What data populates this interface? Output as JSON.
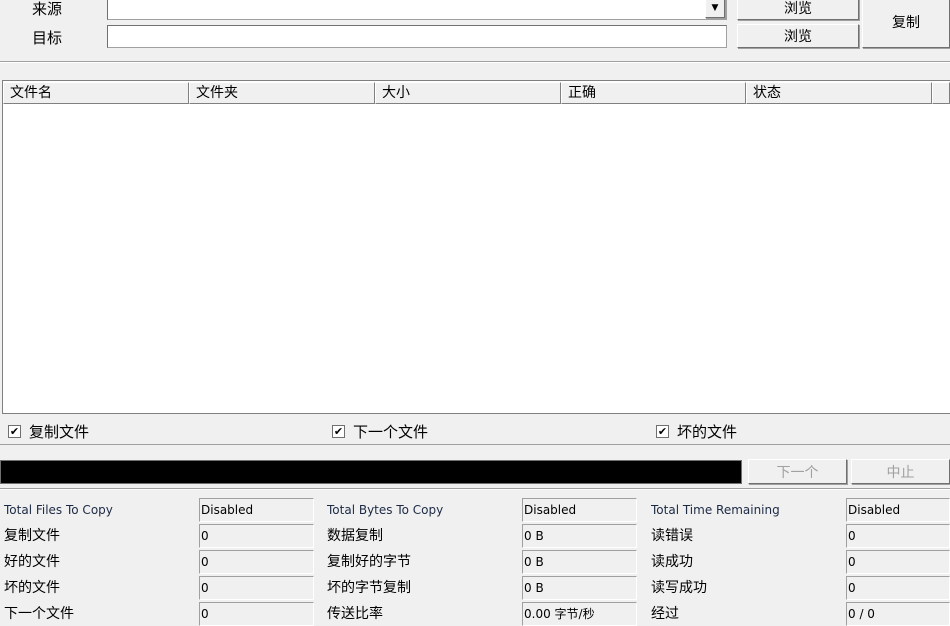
{
  "source": {
    "label": "来源",
    "value": "",
    "browse": "浏览"
  },
  "target": {
    "label": "目标",
    "value": "",
    "browse": "浏览"
  },
  "copy_button": "复制",
  "table": {
    "columns": [
      "文件名",
      "文件夹",
      "大小",
      "正确",
      "状态"
    ]
  },
  "checkboxes": [
    {
      "label": "复制文件",
      "checked": true
    },
    {
      "label": "下一个文件",
      "checked": true
    },
    {
      "label": "坏的文件",
      "checked": true
    }
  ],
  "progress": {
    "percent": 0
  },
  "next_button": "下一个",
  "abort_button": "中止",
  "stats": [
    [
      {
        "label": "Total Files To Copy",
        "value": "Disabled",
        "en": true
      },
      {
        "label": "复制文件",
        "value": "0"
      },
      {
        "label": "好的文件",
        "value": "0"
      },
      {
        "label": "坏的文件",
        "value": "0"
      },
      {
        "label": "下一个文件",
        "value": "0"
      }
    ],
    [
      {
        "label": "Total Bytes To Copy",
        "value": "Disabled",
        "en": true
      },
      {
        "label": "数据复制",
        "value": "0 B"
      },
      {
        "label": "复制好的字节",
        "value": "0 B"
      },
      {
        "label": "坏的字节复制",
        "value": "0 B"
      },
      {
        "label": "传送比率",
        "value": "0.00 字节/秒"
      }
    ],
    [
      {
        "label": "Total Time Remaining",
        "value": "Disabled",
        "en": true
      },
      {
        "label": "读错误",
        "value": "0"
      },
      {
        "label": "读成功",
        "value": "0"
      },
      {
        "label": "读写成功",
        "value": "0"
      },
      {
        "label": "经过",
        "value": "0 / 0"
      }
    ]
  ]
}
